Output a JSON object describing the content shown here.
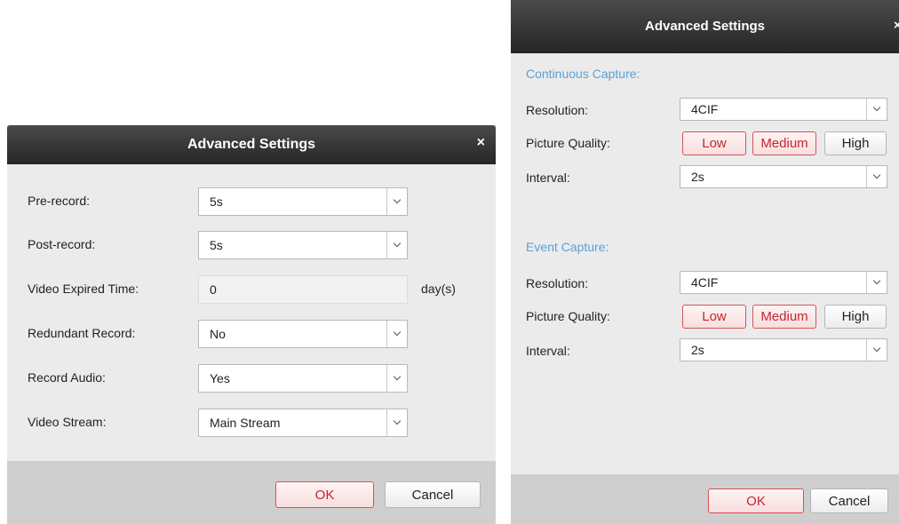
{
  "left_dialog": {
    "title": "Advanced Settings",
    "close_glyph": "×",
    "fields": {
      "pre_record": {
        "label": "Pre-record:",
        "value": "5s"
      },
      "post_record": {
        "label": "Post-record:",
        "value": "5s"
      },
      "video_expired": {
        "label": "Video Expired Time:",
        "value": "0",
        "unit": "day(s)"
      },
      "redundant": {
        "label": "Redundant Record:",
        "value": "No"
      },
      "audio": {
        "label": "Record Audio:",
        "value": "Yes"
      },
      "stream": {
        "label": "Video Stream:",
        "value": "Main Stream"
      }
    },
    "ok_label": "OK",
    "cancel_label": "Cancel"
  },
  "right_dialog": {
    "title": "Advanced Settings",
    "close_glyph": "×",
    "continuous": {
      "heading": "Continuous Capture:",
      "resolution_label": "Resolution:",
      "resolution_value": "4CIF",
      "quality_label": "Picture Quality:",
      "quality_options": [
        "Low",
        "Medium",
        "High"
      ],
      "interval_label": "Interval:",
      "interval_value": "2s"
    },
    "event": {
      "heading": "Event Capture:",
      "resolution_label": "Resolution:",
      "resolution_value": "4CIF",
      "quality_label": "Picture Quality:",
      "quality_options": [
        "Low",
        "Medium",
        "High"
      ],
      "interval_label": "Interval:",
      "interval_value": "2s"
    },
    "ok_label": "OK",
    "cancel_label": "Cancel"
  },
  "colors": {
    "titlebar": "#262626",
    "dialog_bg": "#ebebeb",
    "footer_bg": "#cfcfcf",
    "section_heading": "#58a2d6",
    "accent_red": "#c1272d"
  }
}
